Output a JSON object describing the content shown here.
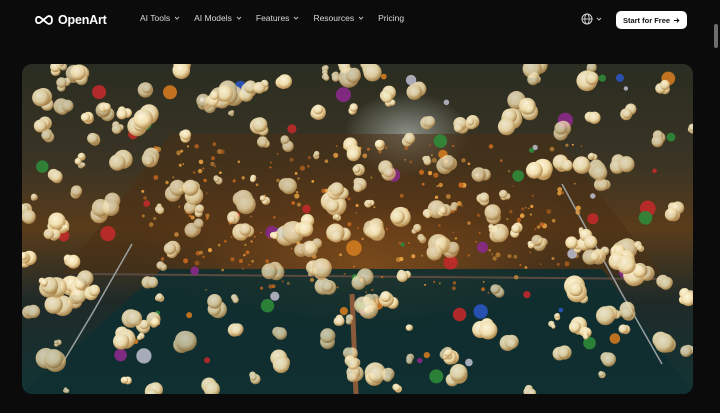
{
  "brand": {
    "name": "OpenArt"
  },
  "nav": {
    "items": [
      {
        "label": "AI Tools",
        "has_dropdown": true
      },
      {
        "label": "AI Models",
        "has_dropdown": true
      },
      {
        "label": "Features",
        "has_dropdown": true
      },
      {
        "label": "Resources",
        "has_dropdown": true
      },
      {
        "label": "Pricing",
        "has_dropdown": false
      }
    ]
  },
  "language": {
    "icon": "globe-icon"
  },
  "cta": {
    "label": "Start for Free",
    "icon": "arrow-right-icon"
  },
  "hero": {
    "media": "popcorn-and-balls-explosion-video"
  },
  "colors": {
    "background": "#0b0b0c",
    "cta_bg": "#ffffff",
    "nav_text": "#d9d9d9"
  }
}
